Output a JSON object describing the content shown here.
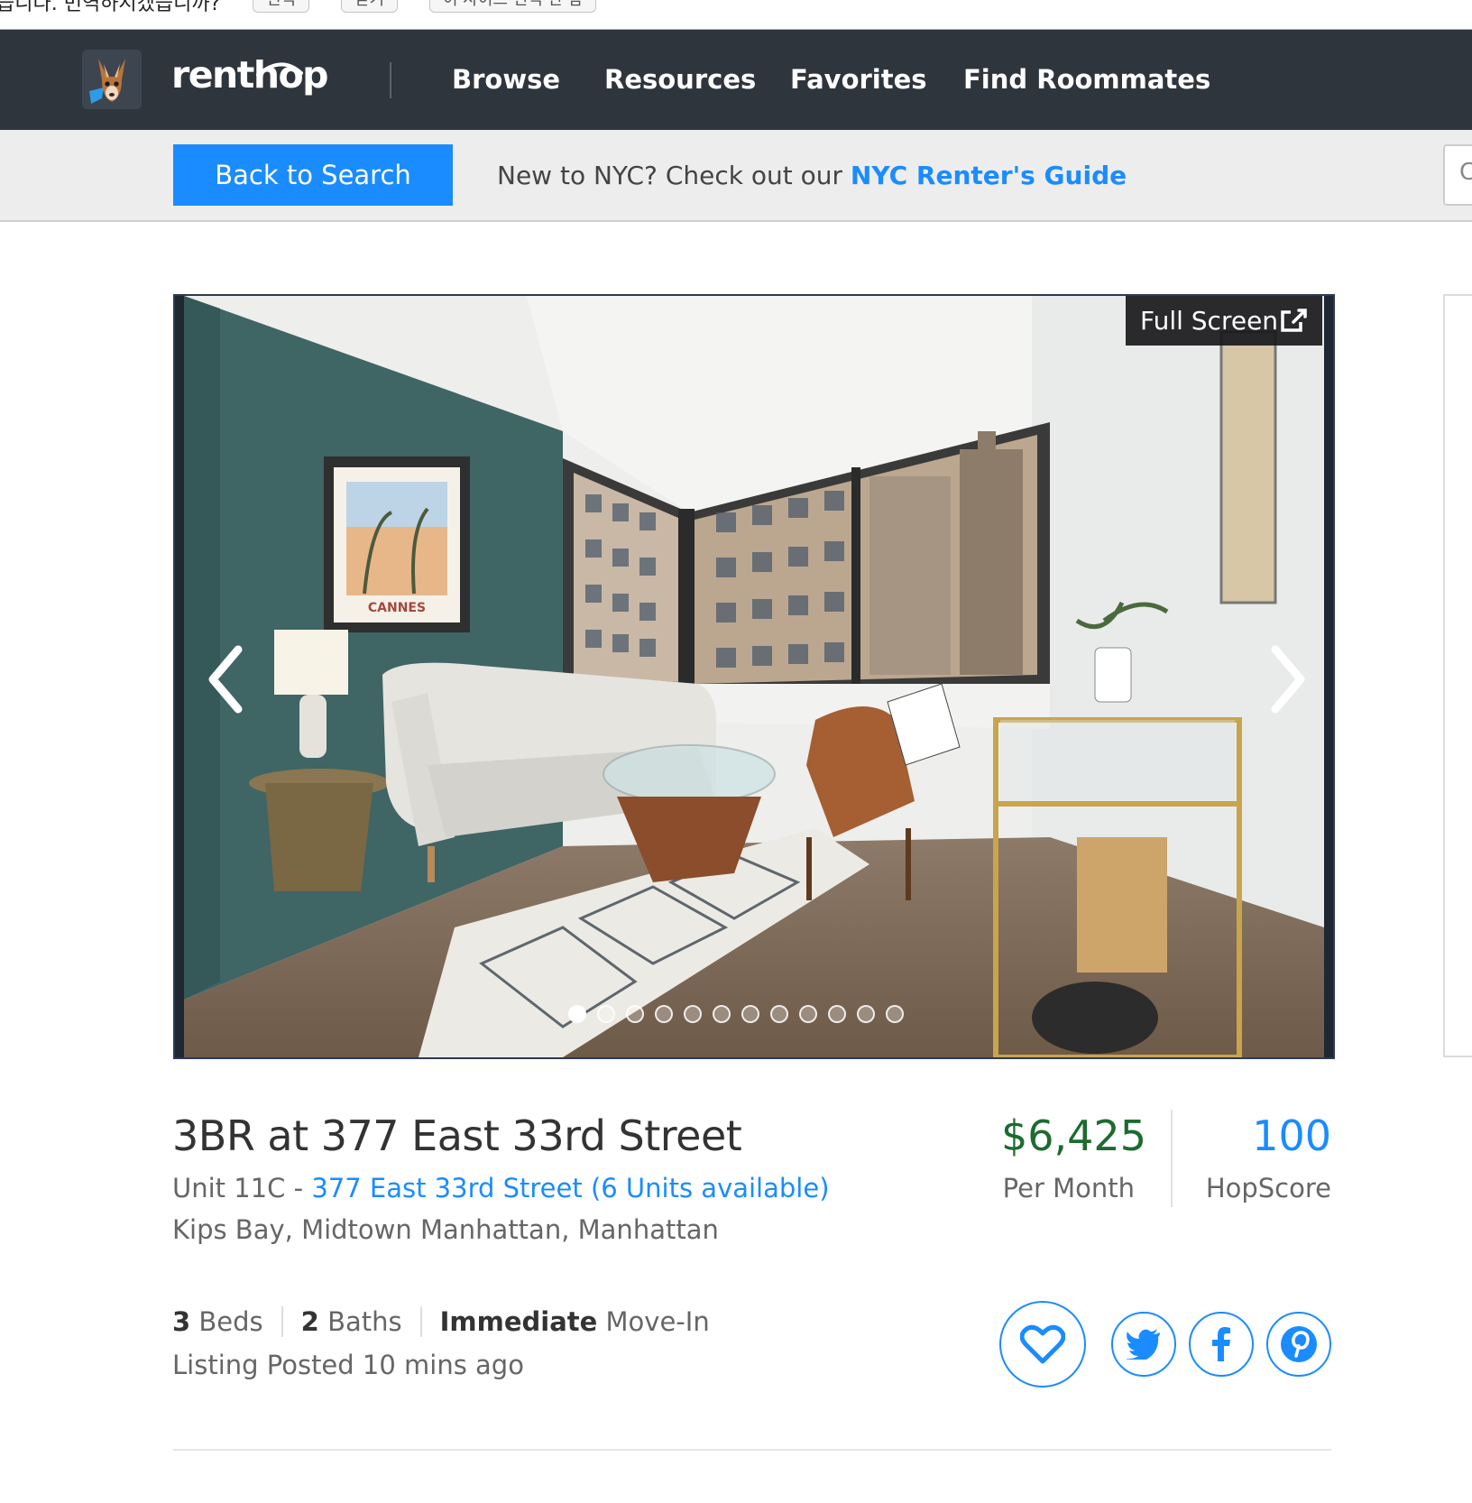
{
  "translate_bar": {
    "message": "습니다. 번역하시겠습니까?",
    "buttons": [
      "번역",
      "닫기",
      "이 사이트 번역 안 함"
    ]
  },
  "nav": {
    "brand": "renthop",
    "links": [
      "Browse",
      "Resources",
      "Favorites",
      "Find Roommates"
    ]
  },
  "subbar": {
    "back_label": "Back to Search",
    "guide_prefix": "New to NYC? Check out our ",
    "guide_link": "NYC Renter's Guide",
    "search_stub_char": "C"
  },
  "gallery": {
    "fullscreen_label": "Full Screen",
    "photo_count": 12,
    "active_index": 0,
    "poster_text": "CANNES"
  },
  "listing": {
    "title": "3BR at 377 East 33rd Street",
    "unit_prefix": "Unit 11C - ",
    "building_link": "377 East 33rd Street (6 Units available)",
    "neighborhood": "Kips Bay, Midtown Manhattan, Manhattan",
    "price": "$6,425",
    "price_label": "Per Month",
    "hopscore": "100",
    "hopscore_label": "HopScore",
    "beds_value": "3",
    "beds_label": " Beds",
    "baths_value": "2",
    "baths_label": " Baths",
    "movein_value": "Immediate",
    "movein_label": " Move-In",
    "posted": "Listing Posted 10 mins ago"
  },
  "actions": [
    "heart-icon",
    "twitter-icon",
    "facebook-icon",
    "pinterest-icon"
  ],
  "colors": {
    "nav_bg": "#2f353d",
    "accent_blue": "#1a8cff",
    "price_green": "#1d6b2f"
  }
}
